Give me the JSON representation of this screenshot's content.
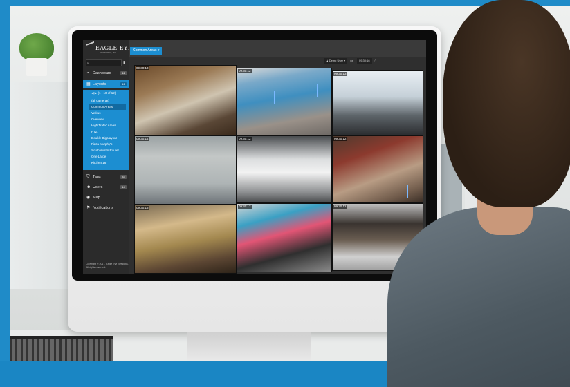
{
  "brand": {
    "logo_text": "EAGLE EYE",
    "logo_sub": "NETWORKS, INC"
  },
  "sidebar": {
    "search_placeholder": "",
    "items": [
      {
        "key": "dashboard",
        "icon": "dashboard-icon",
        "label": "Dashboard",
        "badge": "42"
      },
      {
        "key": "layouts",
        "icon": "layouts-icon",
        "label": "Layouts",
        "badge": "12"
      },
      {
        "key": "tags",
        "icon": "tags-icon",
        "label": "Tags",
        "badge": "33"
      },
      {
        "key": "users",
        "icon": "users-icon",
        "label": "Users",
        "badge": "14"
      },
      {
        "key": "map",
        "icon": "map-icon",
        "label": "Map",
        "badge": ""
      },
      {
        "key": "notifications",
        "icon": "notifications-icon",
        "label": "Notifications",
        "badge": ""
      }
    ],
    "layouts_pager": "(1 - 10 of 12)",
    "layouts": [
      "(all cameras)",
      "Common Areas",
      "Vetkus",
      "Overview",
      "High Traffic Areas",
      "PTZ",
      "Double Big Layout",
      "Pizza Murphy's",
      "South Austin Router",
      "One Large",
      "Kitchen 16"
    ],
    "selected_layout_index": 1,
    "copyright": "Copyright © 2017, Eagle Eye Networks. All rights reserved."
  },
  "topbar": {
    "layout_tab": "Common Areas ▾",
    "user_button": "Demo User ▾",
    "zoom": "4x",
    "time": "09:30:16",
    "fullscreen_icon": "fullscreen-icon"
  },
  "cameras": [
    {
      "timestamp": "09:30:13"
    },
    {
      "timestamp": "09:30:12"
    },
    {
      "timestamp": "09:30:13"
    },
    {
      "timestamp": "09:30:14"
    },
    {
      "timestamp": "09:30:12"
    },
    {
      "timestamp": "09:30:12"
    },
    {
      "timestamp": "09:30:15"
    },
    {
      "timestamp": "09:30:12"
    },
    {
      "timestamp": "09:30:12"
    }
  ],
  "colors": {
    "accent": "#1c8ed1",
    "sidebar_bg": "#2b2b2b",
    "frame": "#1f8bc8"
  }
}
